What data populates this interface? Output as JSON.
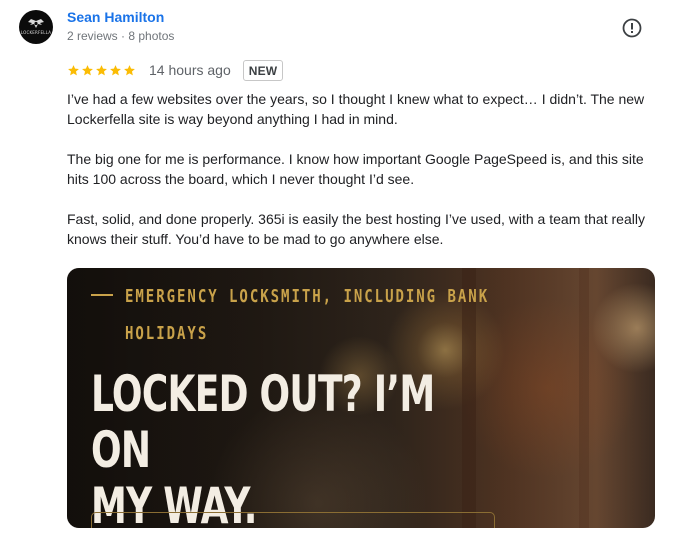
{
  "reviewer": {
    "name": "Sean Hamilton",
    "meta": "2 reviews · 8 photos",
    "avatar_text": "LOCKERFELLA"
  },
  "review": {
    "rating": 5,
    "time": "14 hours ago",
    "badge": "NEW",
    "paragraphs": [
      "I’ve had a few websites over the years, so I thought I knew what to expect… I didn’t. The new Lockerfella site is way beyond anything I had in mind.",
      "The big one for me is performance. I know how important Google PageSpeed is, and this site hits 100 across the board, which I never thought I’d see.",
      "Fast, solid, and done properly. 365i is easily the best hosting I’ve used, with a team that really knows their stuff. You’d have to be mad to go anywhere else."
    ]
  },
  "photo": {
    "eyebrow": "EMERGENCY LOCKSMITH, INCLUDING BANK HOLIDAYS",
    "headline": "LOCKED OUT? I’M ON\nMY WAY."
  },
  "icons": {
    "report": "exclamation-circle-icon",
    "star": "star-icon",
    "logo": "winged-logo-icon"
  },
  "colors": {
    "name_link": "#1a73e8",
    "star": "#fbbc04",
    "photo_accent": "#c9a24a"
  }
}
